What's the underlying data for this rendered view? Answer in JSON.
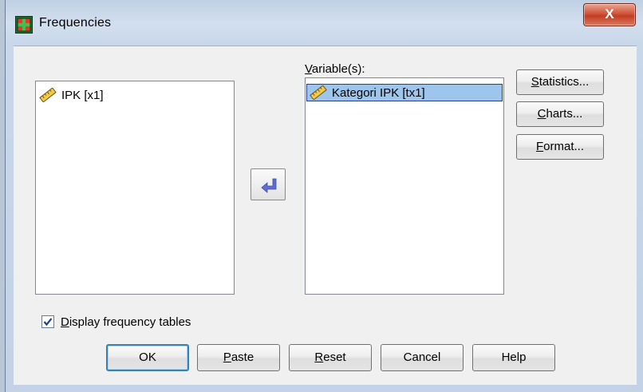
{
  "window": {
    "title": "Frequencies",
    "close_label": "X"
  },
  "source_list": {
    "items": [
      {
        "label": "IPK [x1]",
        "icon": "ruler-icon"
      }
    ]
  },
  "target": {
    "label_underlined": "V",
    "label_rest": "ariable(s):",
    "items": [
      {
        "label": "Kategori IPK [tx1]",
        "icon": "ruler-icon",
        "selected": true
      }
    ]
  },
  "side_buttons": {
    "statistics": {
      "u": "S",
      "rest": "tatistics..."
    },
    "charts": {
      "u": "C",
      "rest": "harts..."
    },
    "format": {
      "u": "F",
      "rest": "ormat..."
    }
  },
  "display_tables": {
    "u": "D",
    "rest": "isplay frequency tables",
    "checked": true
  },
  "bottom_buttons": {
    "ok": "OK",
    "paste": {
      "u": "P",
      "rest": "aste"
    },
    "reset": {
      "u": "R",
      "rest": "eset"
    },
    "cancel": "Cancel",
    "help": "Help"
  },
  "colors": {
    "selection": "#9ec6ec",
    "arrow": "#5f6fd0",
    "close_button": "#c33d22"
  }
}
